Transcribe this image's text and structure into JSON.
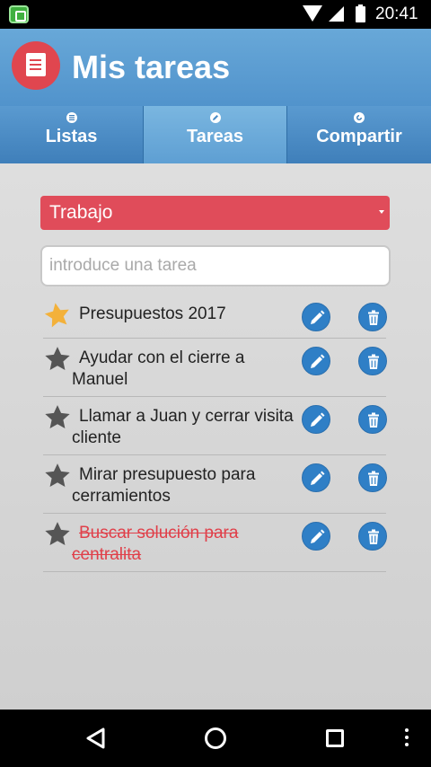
{
  "status_bar": {
    "time": "20:41",
    "icons": [
      "app-notification-icon",
      "wifi-icon",
      "signal-icon",
      "battery-icon"
    ]
  },
  "header": {
    "title": "Mis tareas",
    "logo_icon": "notepad-pencil-icon"
  },
  "tabs": [
    {
      "label": "Listas",
      "icon": "list-icon",
      "active": false
    },
    {
      "label": "Tareas",
      "icon": "pencil-icon",
      "active": true
    },
    {
      "label": "Compartir",
      "icon": "share-icon",
      "active": false
    }
  ],
  "list_select": {
    "selected": "Trabajo"
  },
  "task_input": {
    "value": "",
    "placeholder": "introduce una tarea"
  },
  "tasks": [
    {
      "text": "Presupuestos 2017",
      "starred": true,
      "done": false
    },
    {
      "text": "Ayudar con el cierre a Manuel",
      "starred": false,
      "done": false
    },
    {
      "text": "Llamar a Juan y cerrar visita cliente",
      "starred": false,
      "done": false
    },
    {
      "text": "Mirar presupuesto para cerramientos",
      "starred": false,
      "done": false
    },
    {
      "text": "Buscar solución para centralita",
      "starred": false,
      "done": true
    }
  ],
  "colors": {
    "header_blue": "#5a9ad0",
    "accent_red": "#e04c5a",
    "button_blue": "#2f7fc6",
    "star_gold": "#f3b13a",
    "star_gray": "#555555",
    "done_red": "#e0404a"
  },
  "nav_bar": {
    "icons": [
      "back-icon",
      "home-icon",
      "recents-icon",
      "overflow-menu-icon"
    ]
  }
}
